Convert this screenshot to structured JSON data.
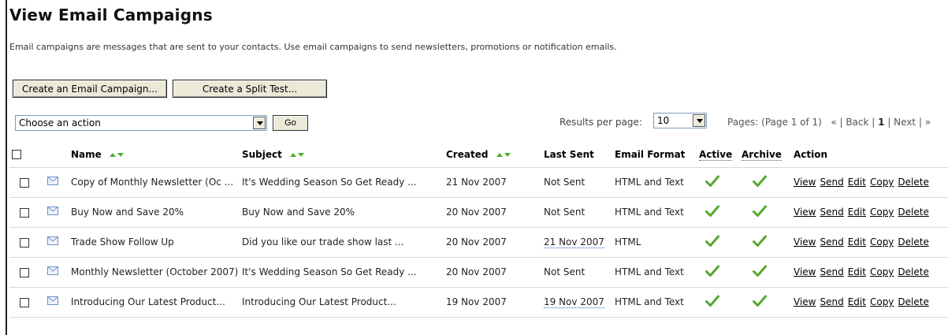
{
  "page": {
    "title": "View Email Campaigns",
    "intro": "Email campaigns are messages that are sent to your contacts. Use email campaigns to send newsletters, promotions or notification emails."
  },
  "buttons": {
    "create_campaign": "Create an Email Campaign...",
    "create_split_test": "Create a Split Test...",
    "go": "Go"
  },
  "action_select": {
    "value": "Choose an action"
  },
  "results": {
    "label": "Results per page:",
    "value": "10"
  },
  "pagination": {
    "summary": "Pages: (Page 1 of 1)",
    "first": "«",
    "back": "Back",
    "current": "1",
    "next": "Next",
    "last": "»"
  },
  "columns": {
    "name": "Name",
    "subject": "Subject",
    "created": "Created",
    "last_sent": "Last Sent",
    "email_format": "Email Format",
    "active": "Active",
    "archive": "Archive",
    "action": "Action"
  },
  "row_actions": [
    "View",
    "Send",
    "Edit",
    "Copy",
    "Delete"
  ],
  "rows": [
    {
      "name": "Copy of Monthly Newsletter (Oc ...",
      "subject": "It's Wedding Season So Get Ready ...",
      "created": "21 Nov 2007",
      "last_sent": "Not Sent",
      "format": "HTML and Text"
    },
    {
      "name": "Buy Now and Save 20%",
      "subject": "Buy Now and Save 20%",
      "created": "20 Nov 2007",
      "last_sent": "Not Sent",
      "format": "HTML and Text"
    },
    {
      "name": "Trade Show Follow Up",
      "subject": "Did you like our trade show last ...",
      "created": "20 Nov 2007",
      "last_sent": "21 Nov 2007",
      "format": "HTML"
    },
    {
      "name": "Monthly Newsletter (October 2007)",
      "subject": "It's Wedding Season So Get Ready ...",
      "created": "20 Nov 2007",
      "last_sent": "Not Sent",
      "format": "HTML and Text"
    },
    {
      "name": "Introducing Our Latest Product...",
      "subject": "Introducing Our Latest Product...",
      "created": "19 Nov 2007",
      "last_sent": "19 Nov 2007",
      "format": "HTML and Text"
    }
  ],
  "colors": {
    "check_green": "#55a82f",
    "envelope_blue": "#6f8fc8",
    "sort_green": "#4caf2f"
  },
  "icons": {
    "row_type": "envelope-icon",
    "status": "checkmark-icon",
    "sort": "sort-arrows-icon"
  }
}
